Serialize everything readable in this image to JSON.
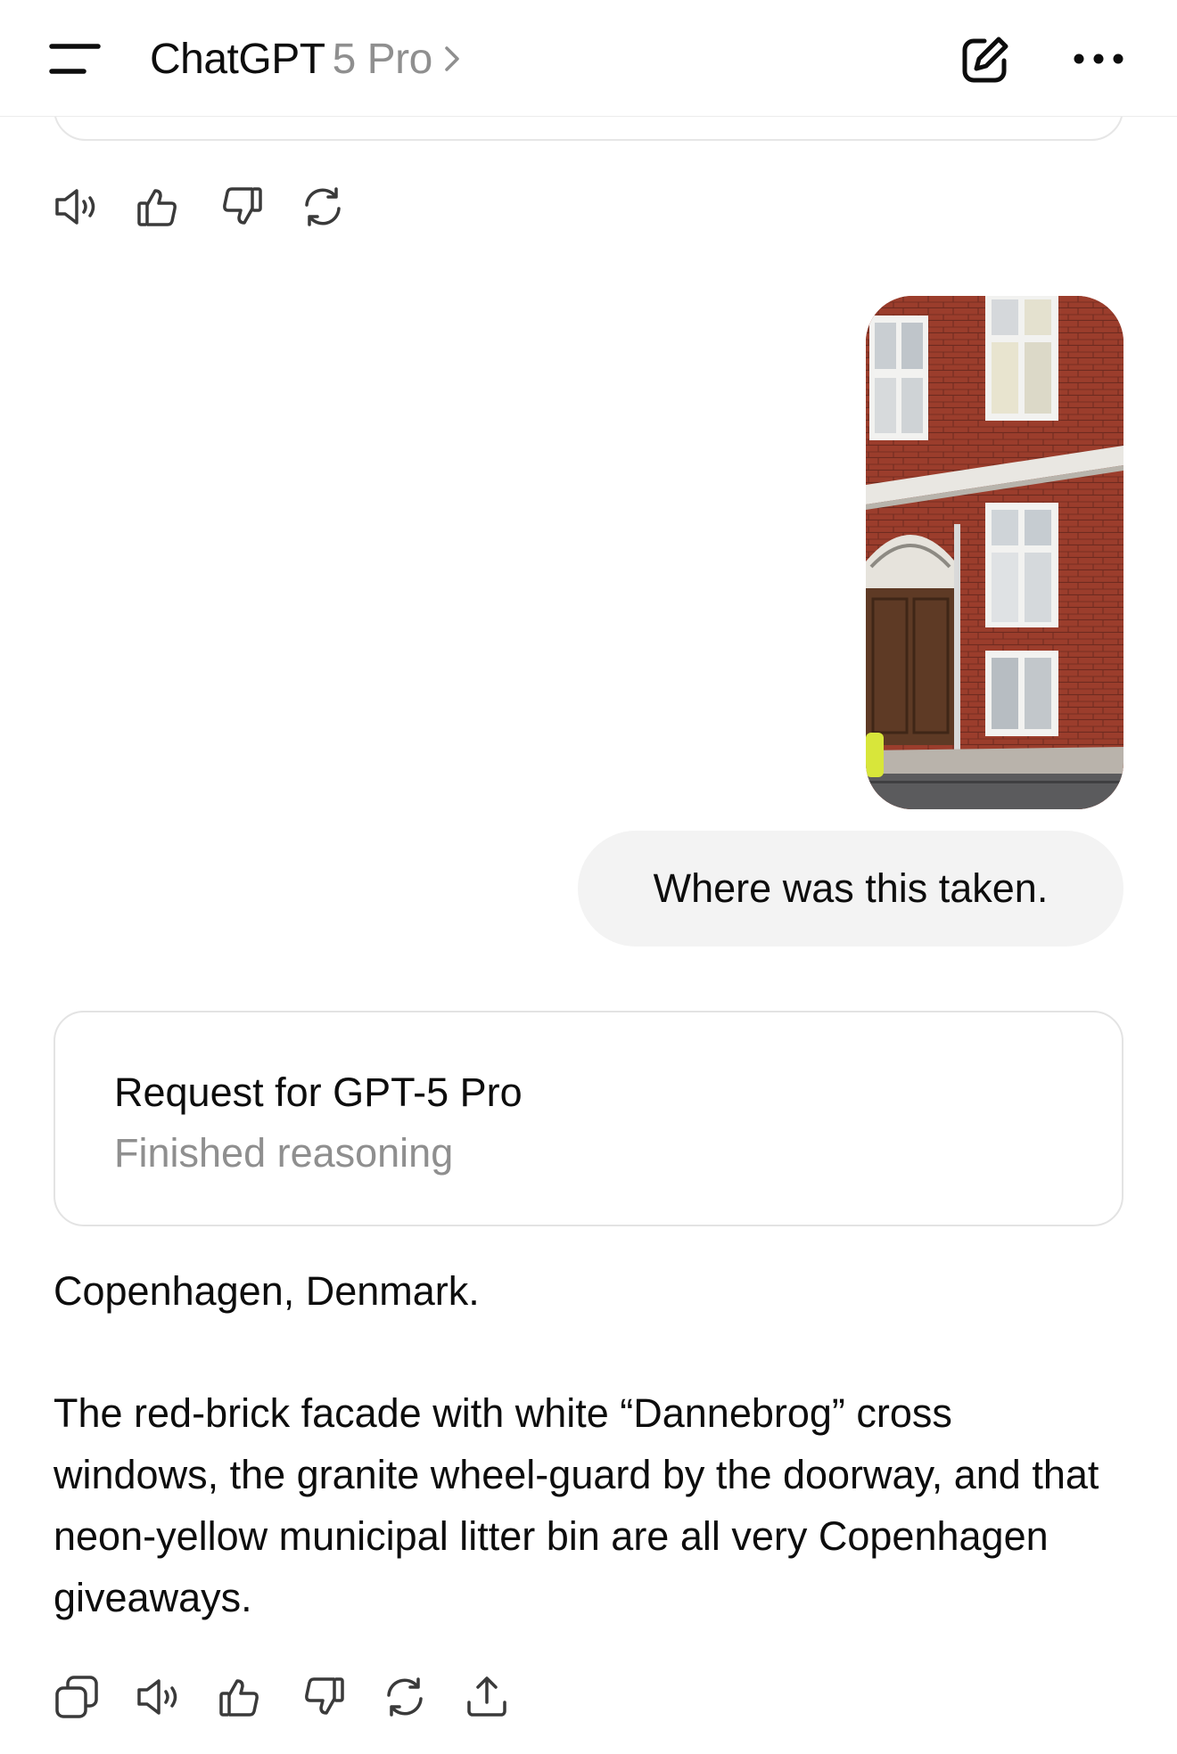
{
  "header": {
    "app_name": "ChatGPT",
    "model_label": "5 Pro",
    "icons": [
      "menu-icon",
      "chevron-right-icon",
      "compose-icon",
      "more-icon"
    ]
  },
  "conversation": {
    "previous_actions": [
      "speaker-icon",
      "thumbs-up-icon",
      "thumbs-down-icon",
      "regenerate-icon"
    ],
    "user_message": "Where was this taken.",
    "reasoning_card": {
      "title": "Request for GPT-5 Pro",
      "status": "Finished reasoning"
    },
    "assistant_answer": {
      "paragraph_1": "Copenhagen, Denmark.",
      "paragraph_2": "The red-brick facade with white “Dannebrog” cross windows, the granite wheel-guard by the doorway, and that neon-yellow municipal litter bin are all very Copenhagen giveaways."
    },
    "answer_actions": [
      "copy-icon",
      "speaker-icon",
      "thumbs-up-icon",
      "thumbs-down-icon",
      "regenerate-icon",
      "share-icon"
    ]
  },
  "colors": {
    "text": "#0d0d0d",
    "muted": "#8f8f8f",
    "bubble": "#f3f3f3",
    "border": "#e3e3e3"
  }
}
